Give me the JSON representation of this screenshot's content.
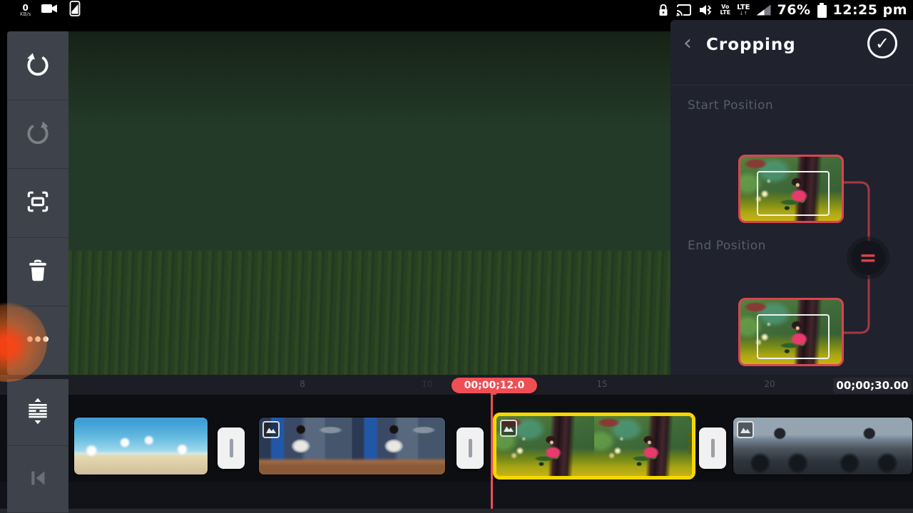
{
  "status_bar": {
    "net_value": "0",
    "net_unit": "KB/s",
    "volte_top": "Vo",
    "volte_bottom": "LTE",
    "lte_label": "LTE",
    "lte_sub": "↓↑",
    "battery_percent": "76%",
    "time": "12:25 pm"
  },
  "sidebar": {
    "buttons": [
      "undo",
      "redo",
      "capture",
      "delete",
      "more"
    ],
    "bottom_buttons": [
      "expand-tracks",
      "skip-to-start"
    ]
  },
  "crop_panel": {
    "back_glyph": "‹",
    "title": "Cropping",
    "confirm_glyph": "✓",
    "start_label": "Start Position",
    "end_label": "End Position",
    "equals_glyph": "=",
    "accent_color": "#d94550"
  },
  "timeline": {
    "current_time": "00;00;12.0",
    "total_time": "00;00;30.00",
    "ruler_ticks": [
      "8",
      "10",
      "15",
      "20"
    ],
    "selection_color": "#f5d800",
    "playhead_color": "#e8505a",
    "clips": [
      {
        "id": "beach-jump",
        "selected": false
      },
      {
        "id": "cafe-man",
        "selected": false
      },
      {
        "id": "park-girl",
        "selected": true
      },
      {
        "id": "motorbike-bw",
        "selected": false
      }
    ]
  }
}
